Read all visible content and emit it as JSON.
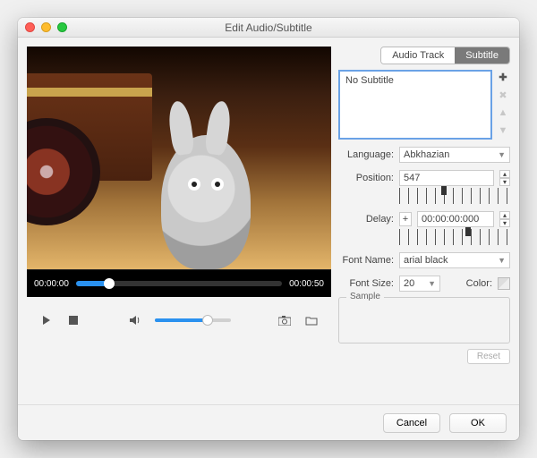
{
  "window": {
    "title": "Edit Audio/Subtitle"
  },
  "tabs": {
    "audio": "Audio Track",
    "subtitle": "Subtitle",
    "active": "subtitle"
  },
  "subtitle_list": {
    "selected": "No Subtitle"
  },
  "icons": {
    "add": "✚",
    "remove": "✖",
    "up": "▲",
    "down": "▼",
    "play": "▶",
    "stop": "■",
    "volume": "🔈",
    "snapshot": "📷",
    "open": "📁"
  },
  "language": {
    "label": "Language:",
    "value": "Abkhazian"
  },
  "position": {
    "label": "Position:",
    "value": "547",
    "marker_pct": 40
  },
  "delay": {
    "label": "Delay:",
    "sign": "+",
    "value": "00:00:00:000",
    "marker_pct": 62
  },
  "font_name": {
    "label": "Font Name:",
    "value": "arial black"
  },
  "font_size": {
    "label": "Font Size:",
    "value": "20"
  },
  "color": {
    "label": "Color:"
  },
  "sample": {
    "label": "Sample"
  },
  "playback": {
    "current": "00:00:00",
    "total": "00:00:50",
    "progress_pct": 16,
    "volume_pct": 70
  },
  "buttons": {
    "reset": "Reset",
    "cancel": "Cancel",
    "ok": "OK"
  }
}
